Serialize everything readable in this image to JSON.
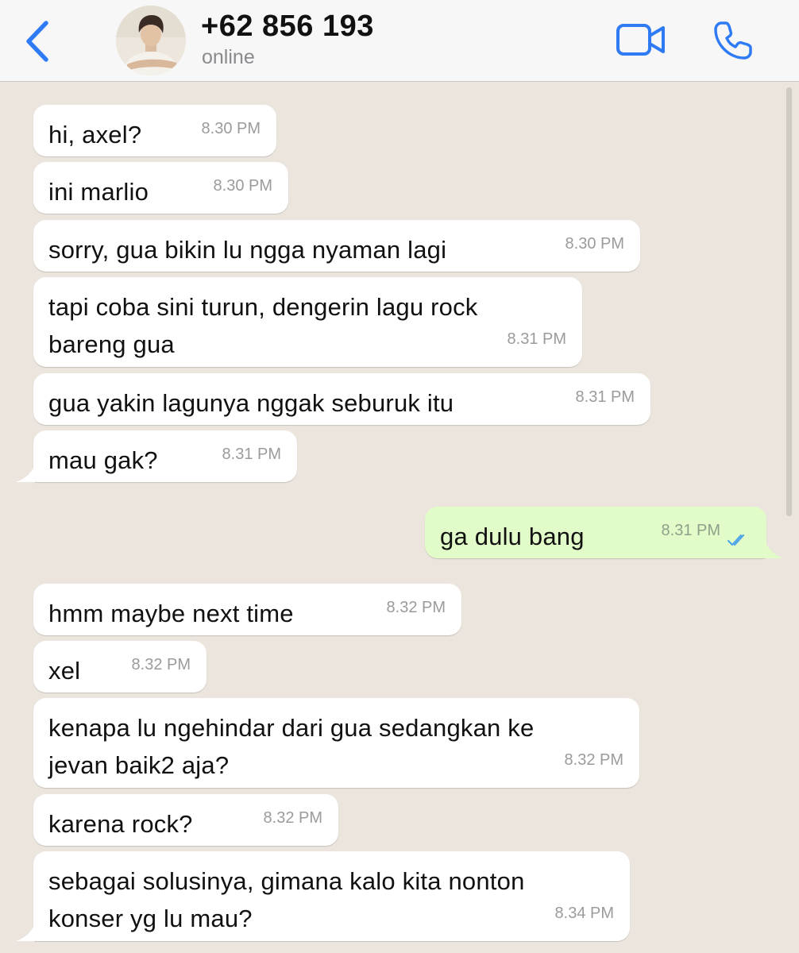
{
  "header": {
    "contact_name": "+62 856 193",
    "status": "online"
  },
  "messages": [
    {
      "text": "hi, axel?",
      "time": "8.30 PM"
    },
    {
      "text": "ini marlio",
      "time": "8.30 PM"
    },
    {
      "text": "sorry, gua bikin lu ngga nyaman lagi",
      "time": "8.30 PM"
    },
    {
      "line1": "tapi coba sini turun, dengerin lagu rock",
      "line2": "bareng gua",
      "time": "8.31 PM"
    },
    {
      "text": "gua yakin lagunya nggak seburuk itu",
      "time": "8.31 PM"
    },
    {
      "text": "mau gak?",
      "time": "8.31 PM"
    },
    {
      "text": "ga dulu bang",
      "time": "8.31 PM"
    },
    {
      "text": "hmm maybe next time",
      "time": "8.32 PM"
    },
    {
      "text": "xel",
      "time": "8.32 PM"
    },
    {
      "line1": "kenapa lu ngehindar dari gua sedangkan ke",
      "line2": "jevan baik2 aja?",
      "time": "8.32 PM"
    },
    {
      "text": "karena rock?",
      "time": "8.32 PM"
    },
    {
      "line1": "sebagai solusinya, gimana kalo kita nonton",
      "line2": "konser yg lu mau?",
      "time": "8.34 PM"
    }
  ],
  "colors": {
    "accent": "#2f7bf5",
    "chat_background": "#ebe5dd",
    "incoming_bubble": "#ffffff",
    "outgoing_bubble": "#e2fcc9",
    "read_ticks": "#4fa6ea"
  },
  "icons": {
    "back": "chevron-left-icon",
    "video": "video-camera-icon",
    "call": "phone-icon",
    "read_receipt": "double-check-icon"
  }
}
